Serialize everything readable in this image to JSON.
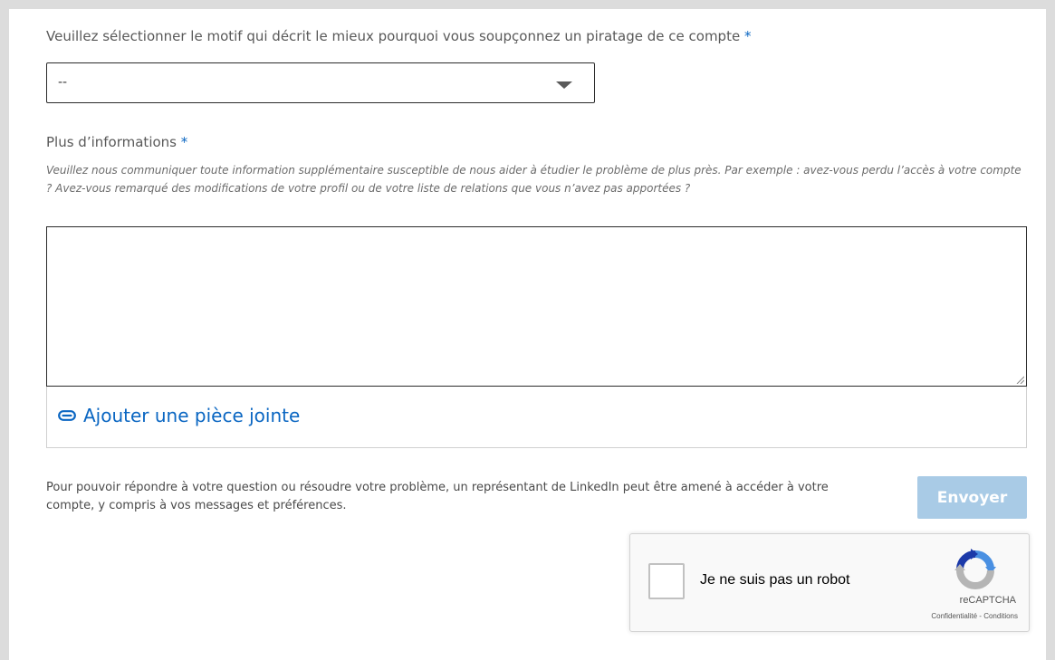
{
  "reason": {
    "label": "Veuillez sélectionner le motif qui décrit le mieux pourquoi vous soupçonnez un piratage de ce compte",
    "required_marker": "*",
    "select_value": "--"
  },
  "details": {
    "label": "Plus d’informations",
    "required_marker": "*",
    "help_text": "Veuillez nous communiquer toute information supplémentaire susceptible de nous aider à étudier le problème de plus près. Par exemple : avez-vous perdu l’accès à votre compte ? Avez-vous remarqué des modifications de votre profil ou de votre liste de relations que vous n’avez pas apportées ?",
    "textarea_value": ""
  },
  "attachment": {
    "label": "Ajouter une pièce jointe",
    "icon": "paperclip-icon"
  },
  "disclaimer": "Pour pouvoir répondre à votre question ou résoudre votre problème, un représentant de LinkedIn peut être amené à accéder à votre compte, y compris à vos messages et préférences.",
  "submit": {
    "label": "Envoyer"
  },
  "recaptcha": {
    "label": "Je ne suis pas un robot",
    "brand": "reCAPTCHA",
    "privacy": "Confidentialité",
    "separator": " - ",
    "terms": "Conditions"
  },
  "colors": {
    "accent": "#0a66c2",
    "submit_disabled": "#a9cbe6",
    "background": "#dcdcdc"
  }
}
